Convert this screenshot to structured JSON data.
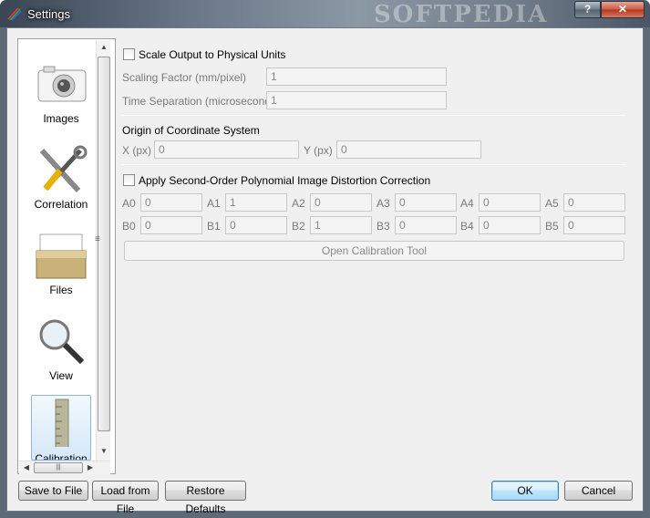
{
  "window": {
    "title": "Settings",
    "help_label": "?",
    "close_label": "✕",
    "watermark": "SOFTPEDIA"
  },
  "sidebar": {
    "items": [
      {
        "label": "Images",
        "icon": "camera-icon"
      },
      {
        "label": "Correlation",
        "icon": "tools-icon"
      },
      {
        "label": "Files",
        "icon": "folder-icon"
      },
      {
        "label": "View",
        "icon": "magnifier-icon"
      },
      {
        "label": "Calibration",
        "icon": "ruler-icon",
        "selected": true
      }
    ],
    "scroll_up": "▲",
    "scroll_down": "▼",
    "scroll_left": "◀",
    "scroll_right": "▶",
    "hthumb_grip": "|||",
    "splitter_grip": "≡"
  },
  "scale": {
    "checkbox_label": "Scale Output to Physical Units",
    "checked": false,
    "scaling_factor_label": "Scaling Factor (mm/pixel)",
    "scaling_factor_value": "1",
    "time_sep_label": "Time Separation (microseconds)",
    "time_sep_value": "1"
  },
  "origin": {
    "heading": "Origin of Coordinate System",
    "x_label": "X (px)",
    "x_value": "0",
    "y_label": "Y (px)",
    "y_value": "0"
  },
  "distortion": {
    "checkbox_label": "Apply Second-Order Polynomial Image Distortion Correction",
    "checked": false,
    "a": [
      {
        "label": "A0",
        "value": "0"
      },
      {
        "label": "A1",
        "value": "1"
      },
      {
        "label": "A2",
        "value": "0"
      },
      {
        "label": "A3",
        "value": "0"
      },
      {
        "label": "A4",
        "value": "0"
      },
      {
        "label": "A5",
        "value": "0"
      }
    ],
    "b": [
      {
        "label": "B0",
        "value": "0"
      },
      {
        "label": "B1",
        "value": "0"
      },
      {
        "label": "B2",
        "value": "1"
      },
      {
        "label": "B3",
        "value": "0"
      },
      {
        "label": "B4",
        "value": "0"
      },
      {
        "label": "B5",
        "value": "0"
      }
    ],
    "calib_button": "Open Calibration Tool"
  },
  "footer": {
    "save_label": "Save to File",
    "load_label": "Load from File",
    "restore_label": "Restore Defaults",
    "ok_label": "OK",
    "cancel_label": "Cancel"
  }
}
